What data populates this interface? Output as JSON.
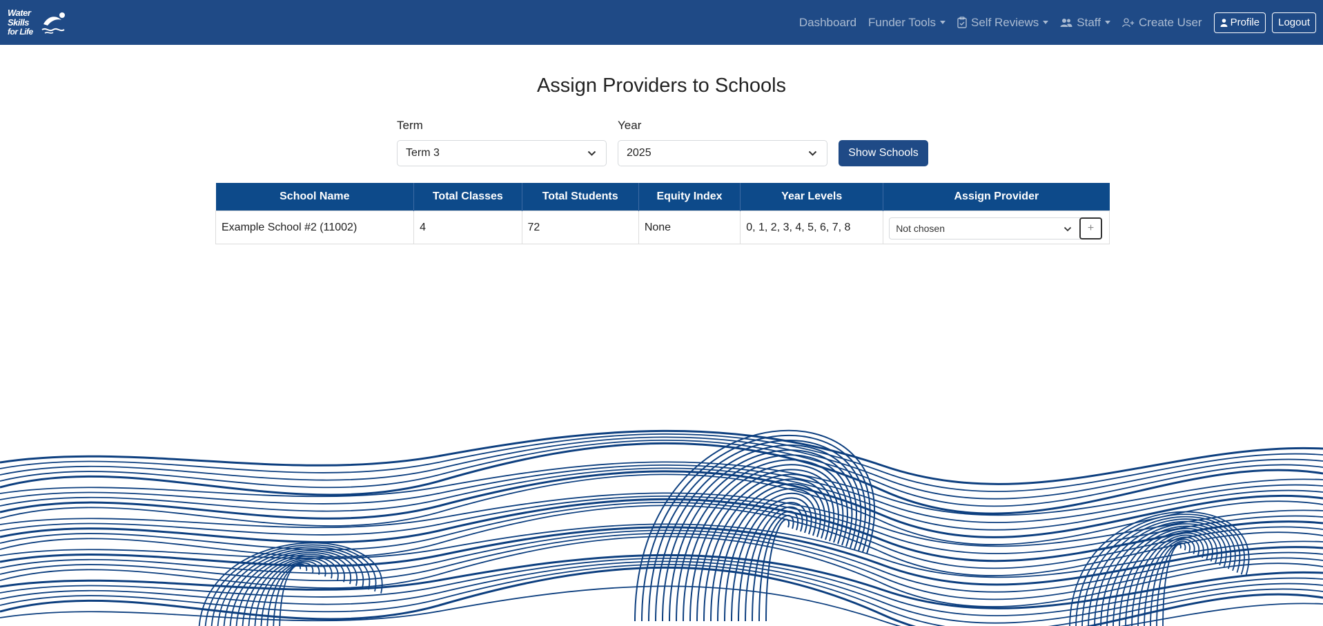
{
  "brand": {
    "logo_lines": [
      "Water",
      "Skills",
      "for Life"
    ]
  },
  "nav": {
    "dashboard": "Dashboard",
    "funder_tools": "Funder Tools",
    "self_reviews": "Self Reviews",
    "staff": "Staff",
    "create_user": "Create User",
    "profile": "Profile",
    "logout": "Logout"
  },
  "page": {
    "title": "Assign Providers to Schools"
  },
  "filters": {
    "term_label": "Term",
    "term_value": "Term 3",
    "year_label": "Year",
    "year_value": "2025",
    "submit_label": "Show Schools"
  },
  "table": {
    "columns": [
      "School Name",
      "Total Classes",
      "Total Students",
      "Equity Index",
      "Year Levels",
      "Assign Provider"
    ],
    "rows": [
      {
        "school_name": "Example School #2 (11002)",
        "total_classes": "4",
        "total_students": "72",
        "equity_index": "None",
        "year_levels": "0, 1, 2, 3, 4, 5, 6, 7, 8",
        "provider": "Not chosen"
      }
    ],
    "add_label": "+"
  },
  "colors": {
    "navbar": "#1f4a86",
    "table_header": "#0d4a8a",
    "wave": "#0d3f7f"
  }
}
